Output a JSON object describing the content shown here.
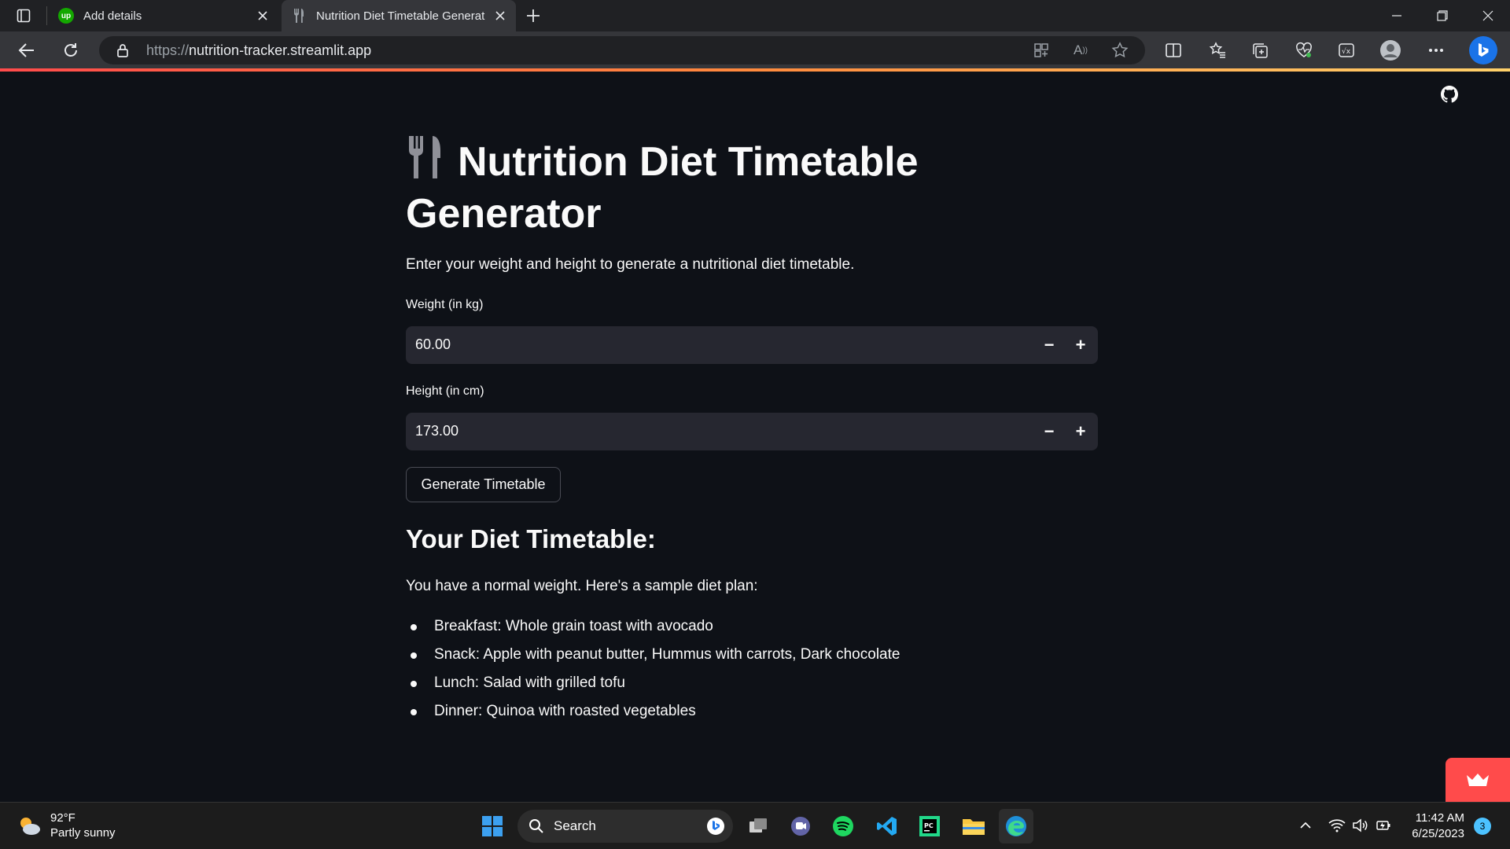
{
  "browser": {
    "tabs": [
      {
        "title": "Add details",
        "favicon": "upwork-icon",
        "active": false
      },
      {
        "title": "Nutrition Diet Timetable Generat",
        "favicon": "fork-knife-icon",
        "active": true
      }
    ],
    "url_proto": "https://",
    "url_host": "nutrition-tracker.streamlit.app"
  },
  "app": {
    "title": "Nutrition Diet Timetable Generator",
    "intro": "Enter your weight and height to generate a nutritional diet timetable.",
    "weight": {
      "label": "Weight (in kg)",
      "value": "60.00",
      "minus": "−",
      "plus": "+"
    },
    "height": {
      "label": "Height (in cm)",
      "value": "173.00",
      "minus": "−",
      "plus": "+"
    },
    "button": "Generate Timetable",
    "result_heading": "Your Diet Timetable:",
    "summary": "You have a normal weight. Here's a sample diet plan:",
    "meals": [
      "Breakfast: Whole grain toast with avocado",
      "Snack: Apple with peanut butter, Hummus with carrots, Dark chocolate",
      "Lunch: Salad with grilled tofu",
      "Dinner: Quinoa with roasted vegetables"
    ]
  },
  "taskbar": {
    "weather_temp": "92°F",
    "weather_desc": "Partly sunny",
    "search": "Search",
    "time": "11:42 AM",
    "date": "6/25/2023",
    "notifications": "3"
  },
  "colors": {
    "streamlit_red": "#ff4b4b",
    "app_bg": "#0e1117",
    "input_bg": "#262730"
  }
}
